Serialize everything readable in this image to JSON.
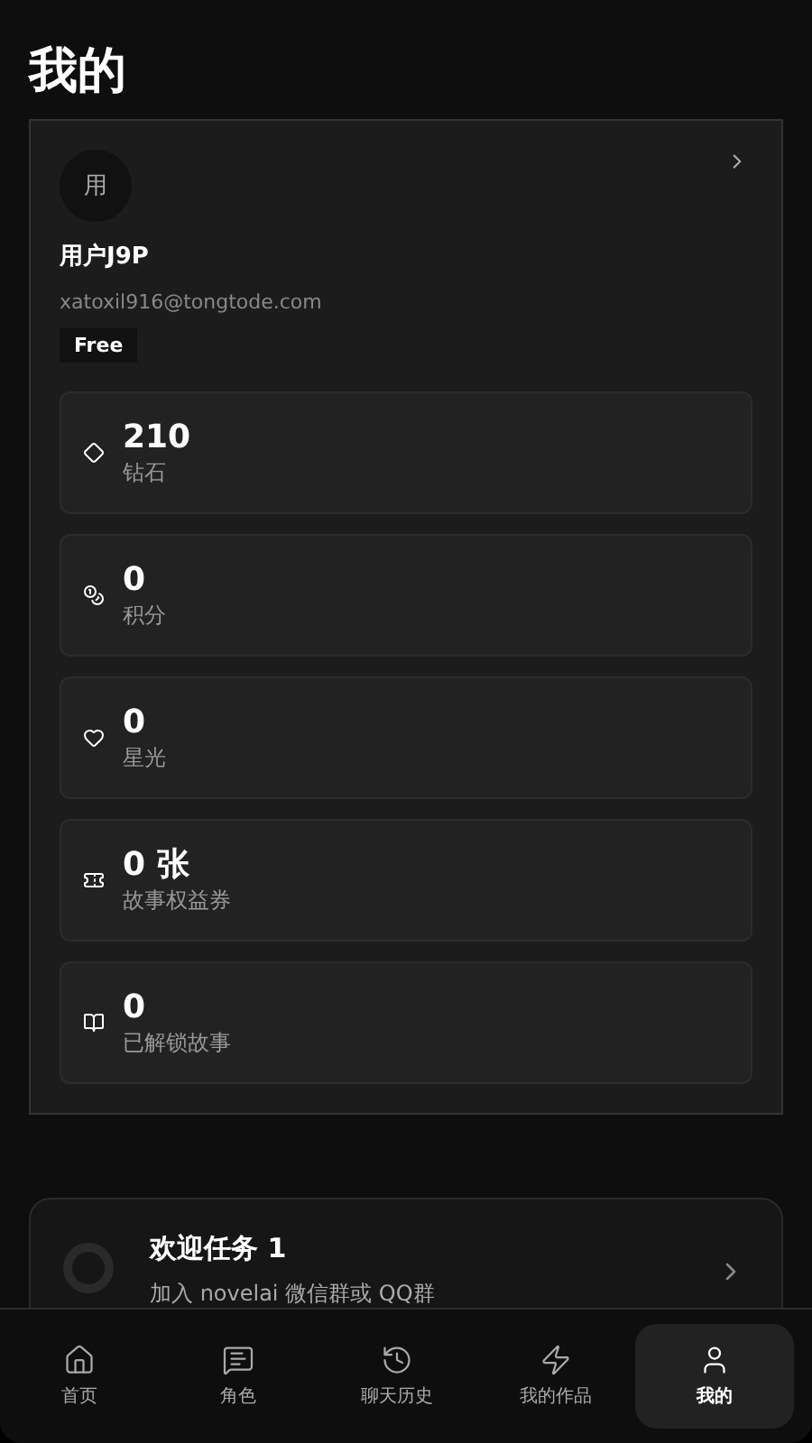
{
  "page_title": "我的",
  "profile": {
    "avatar": "用",
    "name": "用户J9P",
    "email": "xatoxil916@tongtode.com",
    "plan": "Free"
  },
  "stats": [
    {
      "value": "210",
      "label": "钻石"
    },
    {
      "value": "0",
      "label": "积分"
    },
    {
      "value": "0",
      "label": "星光"
    },
    {
      "value": "0 张",
      "label": "故事权益券"
    },
    {
      "value": "0",
      "label": "已解锁故事"
    }
  ],
  "task": {
    "title": "欢迎任务 1",
    "subtitle": "加入 novelai 微信群或 QQ群"
  },
  "nav": [
    {
      "label": "首页",
      "selected": false
    },
    {
      "label": "角色",
      "selected": false
    },
    {
      "label": "聊天历史",
      "selected": false
    },
    {
      "label": "我的作品",
      "selected": false
    },
    {
      "label": "我的",
      "selected": true
    }
  ]
}
